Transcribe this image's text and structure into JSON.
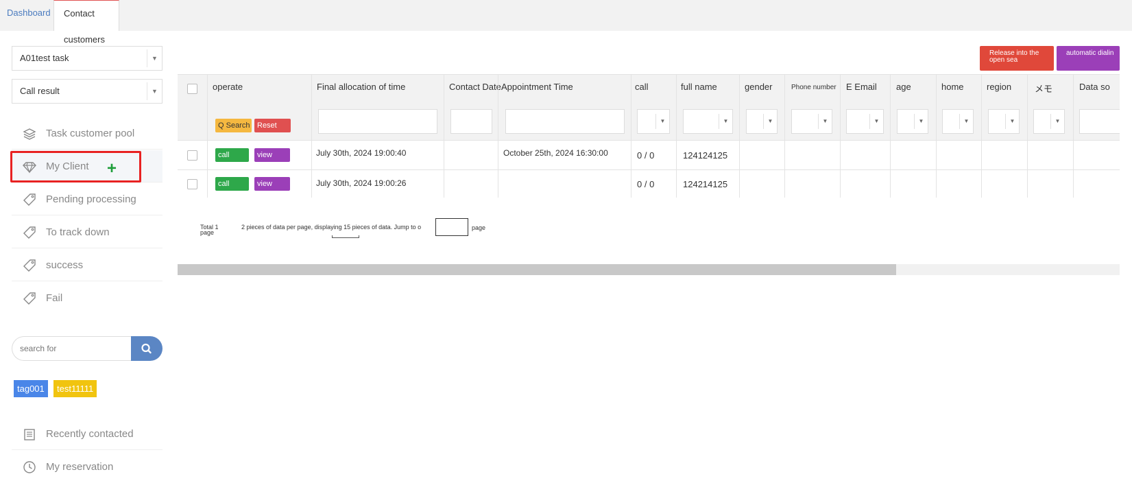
{
  "tabs": [
    {
      "label": "Dashboard"
    },
    {
      "label": "Contact customers"
    }
  ],
  "sidebar": {
    "task_select": "A01test task",
    "result_select": "Call result",
    "nav_items": [
      {
        "label": "Task customer pool",
        "icon": "layers-icon"
      },
      {
        "label": "My Client",
        "icon": "diamond-icon"
      },
      {
        "label": "Pending processing",
        "icon": "tag-icon"
      },
      {
        "label": "To track down",
        "icon": "tag-icon"
      },
      {
        "label": "success",
        "icon": "tag-icon"
      },
      {
        "label": "Fail",
        "icon": "tag-icon"
      }
    ],
    "search_placeholder": "search for",
    "tags": [
      {
        "label": "tag001",
        "color": "#4a86e8"
      },
      {
        "label": "test11111",
        "color": "#f1c40f"
      }
    ],
    "bottom_items": [
      {
        "label": "Recently contacted",
        "icon": "book-icon"
      },
      {
        "label": "My reservation",
        "icon": "clock-icon"
      }
    ]
  },
  "toolbar": {
    "release_label": "Release into the open sea",
    "auto_dial_label": "automatic dialin"
  },
  "table": {
    "columns": [
      "operate",
      "Final allocation of time",
      "Contact Date",
      "Appointment Time",
      "call",
      "full name",
      "gender",
      "Phone number",
      "E Email",
      "age",
      "home",
      "region",
      "メモ",
      "Data so"
    ],
    "search_button": "Q Search",
    "reset_button": "Reset",
    "call_button": "call",
    "view_button": "view",
    "rows": [
      {
        "final_allocation": "July 30th, 2024 19:00:40",
        "appointment": "October 25th, 2024 16:30:00",
        "call": "0 / 0",
        "full_name": "124124125"
      },
      {
        "final_allocation": "July 30th, 2024 19:00:26",
        "appointment": "",
        "call": "0 / 0",
        "full_name": "124214125"
      }
    ]
  },
  "pagination": {
    "total": "Total 1",
    "page_word": "page",
    "text": "2 pieces of data per page, displaying 15 pieces of data. Jump to o",
    "page_suffix": "page"
  },
  "colors": {
    "accent_blue": "#5b86c4",
    "call_green": "#2ea84a",
    "view_purple": "#9b3fb8",
    "release_red": "#e0483a",
    "auto_purple": "#9b3fb8",
    "search_orange": "#f5b840",
    "reset_red": "#e05050",
    "highlight_red": "#e82222"
  }
}
